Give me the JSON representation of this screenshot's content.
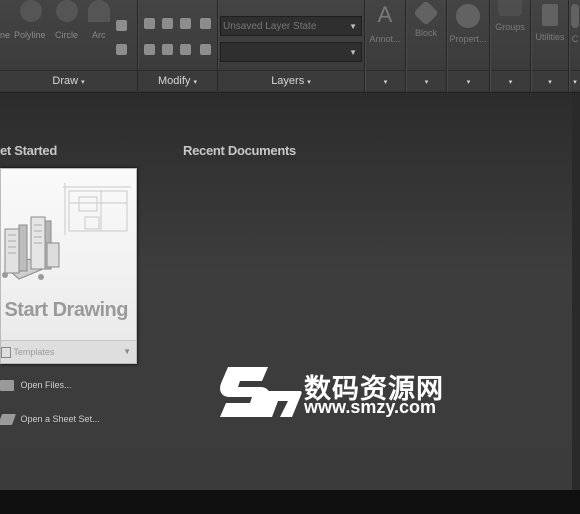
{
  "ribbon": {
    "tools": {
      "line": "ne",
      "polyline": "Polyline",
      "circle": "Circle",
      "arc": "Arc"
    },
    "panels": {
      "draw": "Draw",
      "modify": "Modify",
      "layers": "Layers"
    },
    "layer_state": "Unsaved Layer State",
    "big_tools": {
      "annotation": "Annot...",
      "block": "Block",
      "properties": "Propert...",
      "groups": "Groups",
      "utilities": "Utilities",
      "clip": "C"
    },
    "panel_caret": "▾"
  },
  "start": {
    "get_started_title": "et Started",
    "recent_title": "Recent Documents",
    "card_title": "Start Drawing",
    "templates_label": "Templates",
    "open_files": "Open Files...",
    "open_sheet_set": "Open a Sheet Set..."
  },
  "watermark": {
    "chinese": "数码资源网",
    "url": "www.smzy.com"
  }
}
